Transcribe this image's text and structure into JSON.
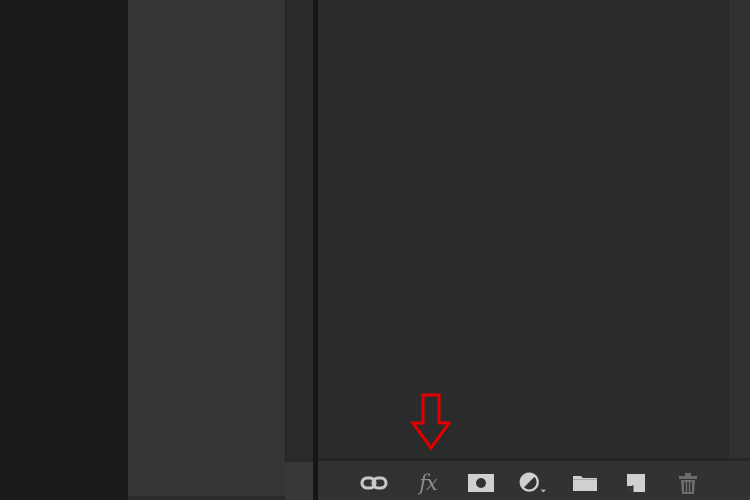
{
  "footer": {
    "fx_label": "fx",
    "icons": [
      {
        "name": "link-icon"
      },
      {
        "name": "fx-icon"
      },
      {
        "name": "mask-icon"
      },
      {
        "name": "adjustment-icon"
      },
      {
        "name": "folder-icon"
      },
      {
        "name": "new-layer-icon"
      },
      {
        "name": "trash-icon"
      }
    ]
  },
  "colors": {
    "panel_bg": "#2b2b2b",
    "footer_bg": "#323232",
    "icon_color": "#c8c8c8",
    "icon_dim": "#8c8c8c",
    "annotation": "#e00000"
  }
}
